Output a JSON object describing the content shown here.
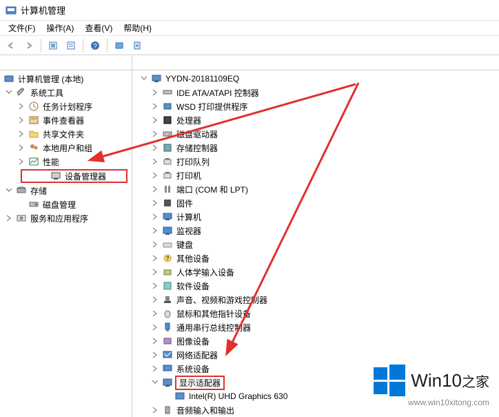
{
  "title": "计算机管理",
  "menubar": {
    "file": "文件(F)",
    "action": "操作(A)",
    "view": "查看(V)",
    "help": "帮助(H)"
  },
  "toolbar_icons": [
    "back",
    "forward",
    "up",
    "show-hide",
    "export",
    "help",
    "scan",
    "open"
  ],
  "left": {
    "root": "计算机管理 (本地)",
    "sys_tools": "系统工具",
    "task_scheduler": "任务计划程序",
    "event_viewer": "事件查看器",
    "shared_folders": "共享文件夹",
    "local_users": "本地用户和组",
    "performance": "性能",
    "device_manager": "设备管理器",
    "storage": "存储",
    "disk_mgmt": "磁盘管理",
    "services_apps": "服务和应用程序"
  },
  "right": {
    "root": "YYDN-20181109EQ",
    "items": [
      "IDE ATA/ATAPI 控制器",
      "WSD 打印提供程序",
      "处理器",
      "磁盘驱动器",
      "存储控制器",
      "打印队列",
      "打印机",
      "端口 (COM 和 LPT)",
      "固件",
      "计算机",
      "监视器",
      "键盘",
      "其他设备",
      "人体学输入设备",
      "软件设备",
      "声音、视频和游戏控制器",
      "鼠标和其他指针设备",
      "通用串行总线控制器",
      "图像设备",
      "网络适配器",
      "系统设备",
      "显示适配器",
      "音频输入和输出"
    ],
    "display_child": "Intel(R) UHD Graphics 630"
  },
  "watermark": {
    "brand": "Win10",
    "suffix": "之家",
    "url": "www.win10xitong.com"
  }
}
